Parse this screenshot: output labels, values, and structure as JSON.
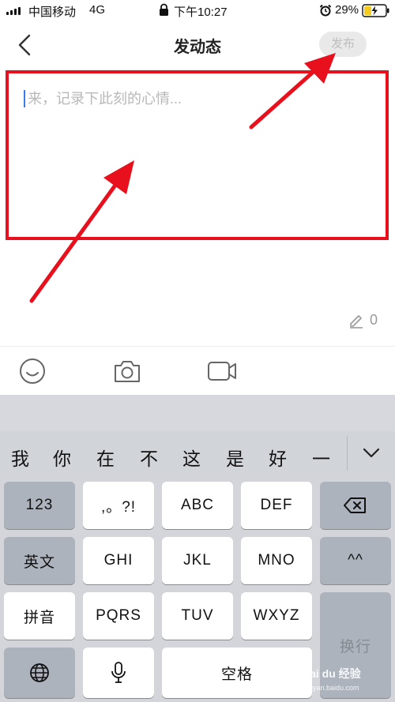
{
  "status_bar": {
    "carrier": "中国移动",
    "network": "4G",
    "time": "下午10:27",
    "battery": "29%"
  },
  "nav": {
    "title": "发动态",
    "publish_label": "发布"
  },
  "compose": {
    "placeholder": "来，记录下此刻的心情..."
  },
  "char_count": "0",
  "toolbar": {
    "icons": [
      "emoji-icon",
      "camera-icon",
      "video-icon"
    ]
  },
  "keyboard": {
    "candidates": [
      "我",
      "你",
      "在",
      "不",
      "这",
      "是",
      "好",
      "一"
    ],
    "keys": {
      "num": "123",
      "punct": ",。?!",
      "abc": "ABC",
      "def": "DEF",
      "english": "英文",
      "ghi": "GHI",
      "jkl": "JKL",
      "mno": "MNO",
      "emoticon": "^^",
      "pinyin": "拼音",
      "pqrs": "PQRS",
      "tuv": "TUV",
      "wxyz": "WXYZ",
      "enter": "换行",
      "space": "空格"
    }
  },
  "watermark": {
    "brand": "Bai du 经验",
    "url": "jingyan.baidu.com"
  },
  "colors": {
    "annotation": "#e8101c",
    "cursor": "#3a7bf0"
  }
}
